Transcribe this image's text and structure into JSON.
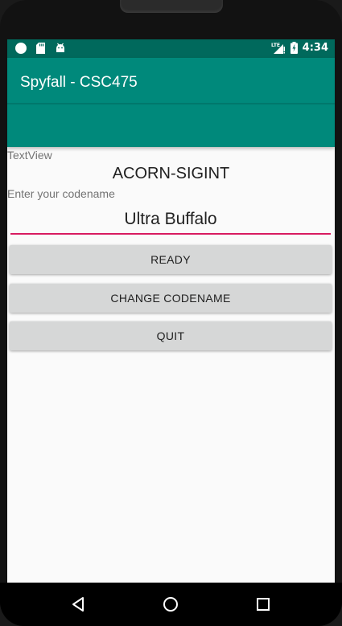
{
  "status_bar": {
    "time": "4:34",
    "network": "LTE",
    "left_icons": [
      "circle-icon",
      "sd-card-icon",
      "android-icon"
    ],
    "right_icons": [
      "signal-icon",
      "battery-icon"
    ]
  },
  "app_bar": {
    "title": "Spyfall - CSC475"
  },
  "main": {
    "textview_label": "TextView",
    "codename_display": "ACORN-SIGINT",
    "input_label": "Enter your codename",
    "codename_value": "Ultra Buffalo",
    "buttons": {
      "ready": "READY",
      "change_codename": "CHANGE CODENAME",
      "quit": "QUIT"
    }
  },
  "nav_bar": {
    "icons": [
      "back-icon",
      "home-icon",
      "recents-icon"
    ]
  },
  "colors": {
    "status_bar": "#00695c",
    "app_bar": "#00897b",
    "accent": "#d81b60",
    "button_bg": "#d6d7d7",
    "background": "#fafafa"
  }
}
